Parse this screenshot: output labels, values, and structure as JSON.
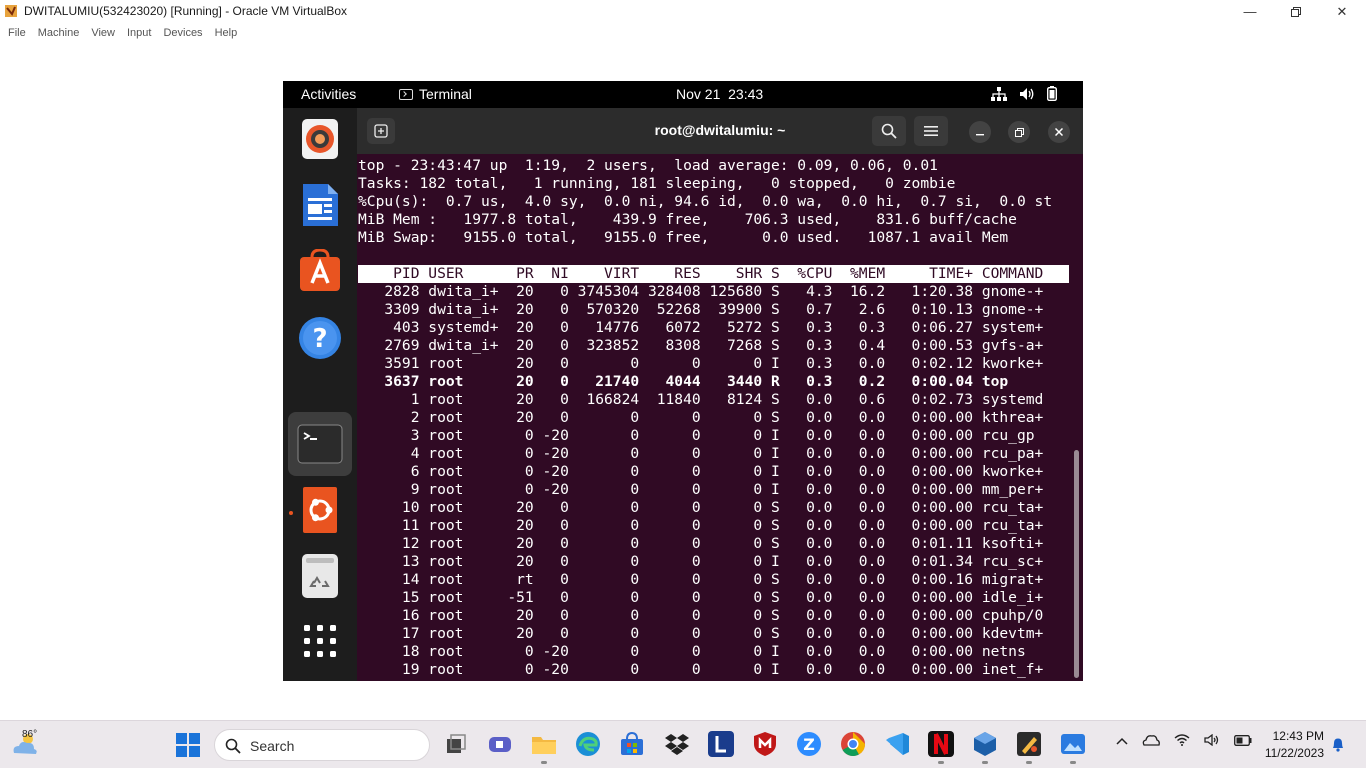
{
  "host": {
    "title": "DWITALUMIU(532423020) [Running] - Oracle VM VirtualBox",
    "menu": [
      "File",
      "Machine",
      "View",
      "Input",
      "Devices",
      "Help"
    ]
  },
  "gnome": {
    "activities": "Activities",
    "app_name": "Terminal",
    "clock": "Nov 21  23:43"
  },
  "terminal": {
    "title": "root@dwitalumiu: ~",
    "summary": [
      "top - 23:43:47 up  1:19,  2 users,  load average: 0.09, 0.06, 0.01",
      "Tasks: 182 total,   1 running, 181 sleeping,   0 stopped,   0 zombie",
      "%Cpu(s):  0.7 us,  4.0 sy,  0.0 ni, 94.6 id,  0.0 wa,  0.0 hi,  0.7 si,  0.0 st",
      "MiB Mem :   1977.8 total,    439.9 free,    706.3 used,    831.6 buff/cache",
      "MiB Swap:   9155.0 total,   9155.0 free,      0.0 used.   1087.1 avail Mem"
    ],
    "blank": " ",
    "header": "    PID USER      PR  NI    VIRT    RES    SHR S  %CPU  %MEM     TIME+ COMMAND",
    "processes": [
      "   2828 dwita_i+  20   0 3745304 328408 125680 S   4.3  16.2   1:20.38 gnome-+",
      "   3309 dwita_i+  20   0  570320  52268  39900 S   0.7   2.6   0:10.13 gnome-+",
      "    403 systemd+  20   0   14776   6072   5272 S   0.3   0.3   0:06.27 system+",
      "   2769 dwita_i+  20   0  323852   8308   7268 S   0.3   0.4   0:00.53 gvfs-a+",
      "   3591 root      20   0       0      0      0 I   0.3   0.0   0:02.12 kworke+",
      "   3637 root      20   0   21740   4044   3440 R   0.3   0.2   0:00.04 top",
      "      1 root      20   0  166824  11840   8124 S   0.0   0.6   0:02.73 systemd",
      "      2 root      20   0       0      0      0 S   0.0   0.0   0:00.00 kthrea+",
      "      3 root       0 -20       0      0      0 I   0.0   0.0   0:00.00 rcu_gp",
      "      4 root       0 -20       0      0      0 I   0.0   0.0   0:00.00 rcu_pa+",
      "      6 root       0 -20       0      0      0 I   0.0   0.0   0:00.00 kworke+",
      "      9 root       0 -20       0      0      0 I   0.0   0.0   0:00.00 mm_per+",
      "     10 root      20   0       0      0      0 S   0.0   0.0   0:00.00 rcu_ta+",
      "     11 root      20   0       0      0      0 S   0.0   0.0   0:00.00 rcu_ta+",
      "     12 root      20   0       0      0      0 S   0.0   0.0   0:01.11 ksofti+",
      "     13 root      20   0       0      0      0 I   0.0   0.0   0:01.34 rcu_sc+",
      "     14 root      rt   0       0      0      0 S   0.0   0.0   0:00.16 migrat+",
      "     15 root     -51   0       0      0      0 S   0.0   0.0   0:00.00 idle_i+",
      "     16 root      20   0       0      0      0 S   0.0   0.0   0:00.00 cpuhp/0",
      "     17 root      20   0       0      0      0 S   0.0   0.0   0:00.00 kdevtm+",
      "     18 root       0 -20       0      0      0 I   0.0   0.0   0:00.00 netns",
      "     19 root       0 -20       0      0      0 I   0.0   0.0   0:00.00 inet_f+"
    ]
  },
  "taskbar": {
    "weather_temp": "86°",
    "search_label": "Search",
    "time": "12:43 PM",
    "date": "11/22/2023"
  }
}
